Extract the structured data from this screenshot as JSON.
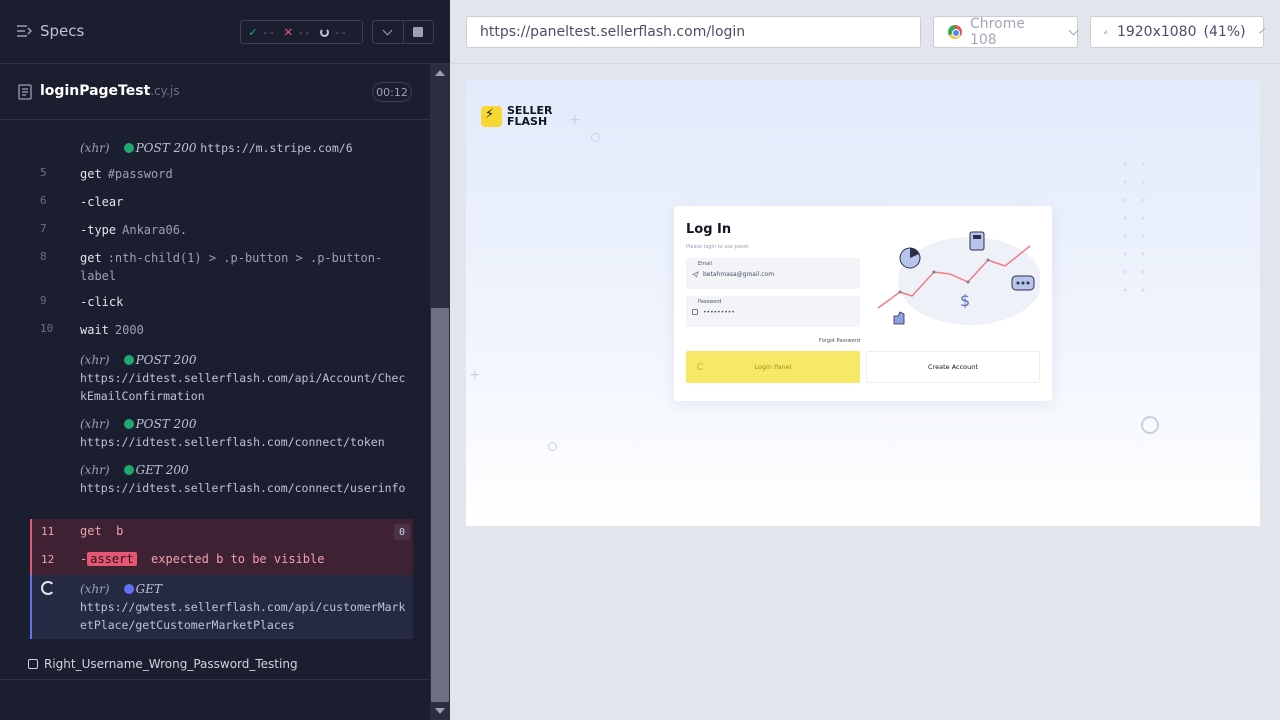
{
  "reporter": {
    "specs_label": "Specs",
    "stats": {
      "passed": "--",
      "failed": "--",
      "pending": "--"
    },
    "spec_name": "loginPageTest",
    "spec_ext": ".cy.js",
    "duration": "00:12",
    "commands": [
      {
        "type": "xhr",
        "tag": "(xhr)",
        "method": "POST 200",
        "url": "https://m.stripe.com/6"
      },
      {
        "type": "cmd",
        "num": "5",
        "name": "get",
        "arg": "#password"
      },
      {
        "type": "cmd",
        "num": "6",
        "name": "-clear",
        "arg": ""
      },
      {
        "type": "cmd",
        "num": "7",
        "name": "-type",
        "arg": "Ankara06."
      },
      {
        "type": "cmd",
        "num": "8",
        "name": "get",
        "arg": ":nth-child(1) > .p-button > .p-button-label"
      },
      {
        "type": "cmd",
        "num": "9",
        "name": "-click",
        "arg": ""
      },
      {
        "type": "cmd",
        "num": "10",
        "name": "wait",
        "arg": "2000"
      },
      {
        "type": "xhr",
        "tag": "(xhr)",
        "method": "POST 200",
        "url": "https://idtest.sellerflash.com/api/Account/CheckEmailConfirmation"
      },
      {
        "type": "xhr",
        "tag": "(xhr)",
        "method": "POST 200",
        "url": "https://idtest.sellerflash.com/connect/token"
      },
      {
        "type": "xhr",
        "tag": "(xhr)",
        "method": "GET 200",
        "url": "https://idtest.sellerflash.com/connect/userinfo"
      }
    ],
    "failed_cmds": {
      "get_num": "11",
      "get_name": "get",
      "get_arg": "b",
      "get_count": "0",
      "assert_num": "12",
      "assert_prefix": "-",
      "assert_label": "assert",
      "assert_msg": "expected b to be visible"
    },
    "pending_xhr": {
      "tag": "(xhr)",
      "method": "GET",
      "url": "https://gwtest.sellerflash.com/api/customerMarketPlace/getCustomerMarketPlaces"
    },
    "next_test": "Right_Username_Wrong_Password_Testing"
  },
  "aut": {
    "url": "https://paneltest.sellerflash.com/login",
    "browser": "Chrome 108",
    "viewport": "1920x1080",
    "scale": "(41%)"
  },
  "app": {
    "logo_text": "SELLER FLASH",
    "login_title": "Log In",
    "login_sub": "Please login to use panel.",
    "email_label": "Email",
    "email_value": "betahmasa@gmail.com",
    "password_label": "Password",
    "password_value": "•••••••••",
    "forgot_label": "Forgot Password",
    "login_button": "Login Panel",
    "create_button": "Create Account"
  },
  "colors": {
    "pass": "#1fa971",
    "fail": "#e45770",
    "pending": "#6470f3",
    "brand_yellow": "#f7d731"
  }
}
